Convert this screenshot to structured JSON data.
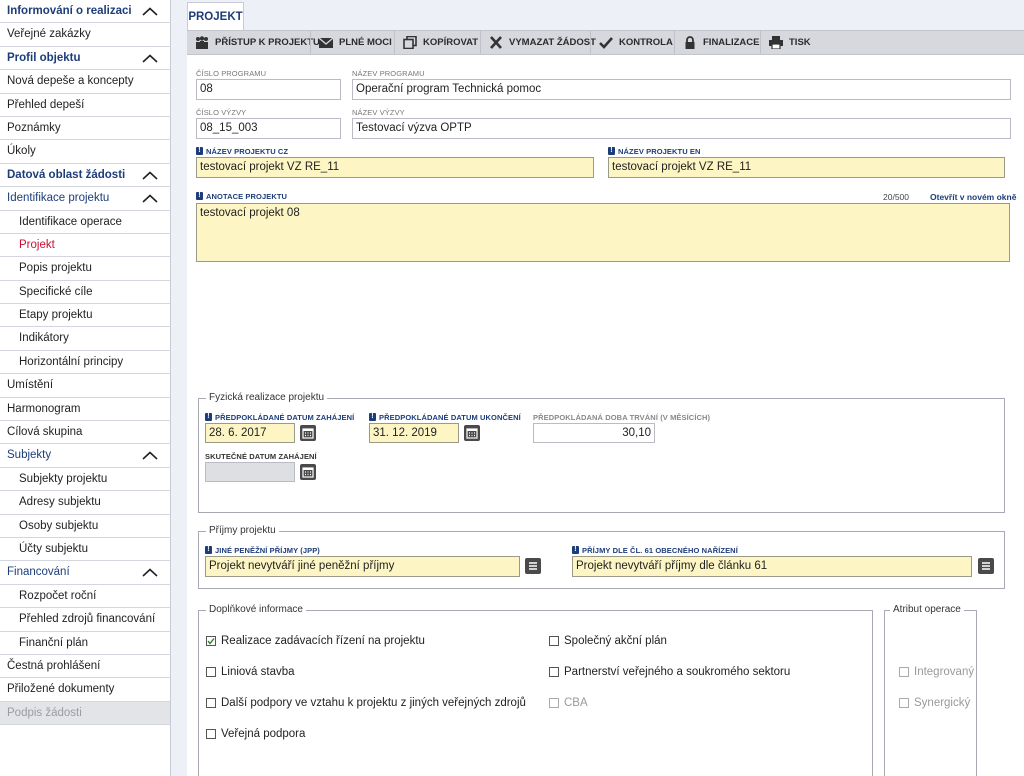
{
  "sidebar": {
    "items": [
      {
        "label": "Informování o realizaci",
        "type": "section",
        "chevron": true
      },
      {
        "label": "Veřejné zakázky",
        "type": "item"
      },
      {
        "label": "Profil objektu",
        "type": "section",
        "chevron": true
      },
      {
        "label": "Nová depeše a koncepty",
        "type": "item"
      },
      {
        "label": "Přehled depeší",
        "type": "item"
      },
      {
        "label": "Poznámky",
        "type": "item"
      },
      {
        "label": "Úkoly",
        "type": "item"
      },
      {
        "label": "Datová oblast žádosti",
        "type": "section",
        "chevron": true
      },
      {
        "label": "Identifikace projektu",
        "type": "section-light",
        "chevron": true
      },
      {
        "label": "Identifikace operace",
        "type": "sub"
      },
      {
        "label": "Projekt",
        "type": "sub-active"
      },
      {
        "label": "Popis projektu",
        "type": "sub"
      },
      {
        "label": "Specifické cíle",
        "type": "sub"
      },
      {
        "label": "Etapy projektu",
        "type": "sub"
      },
      {
        "label": "Indikátory",
        "type": "sub"
      },
      {
        "label": "Horizontální principy",
        "type": "sub"
      },
      {
        "label": "Umístění",
        "type": "item"
      },
      {
        "label": "Harmonogram",
        "type": "item"
      },
      {
        "label": "Cílová skupina",
        "type": "item"
      },
      {
        "label": "Subjekty",
        "type": "section-light",
        "chevron": true
      },
      {
        "label": "Subjekty projektu",
        "type": "sub"
      },
      {
        "label": "Adresy subjektu",
        "type": "sub"
      },
      {
        "label": "Osoby subjektu",
        "type": "sub"
      },
      {
        "label": "Účty subjektu",
        "type": "sub"
      },
      {
        "label": "Financování",
        "type": "section-light",
        "chevron": true
      },
      {
        "label": "Rozpočet roční",
        "type": "sub"
      },
      {
        "label": "Přehled zdrojů financování",
        "type": "sub"
      },
      {
        "label": "Finanční plán",
        "type": "sub"
      },
      {
        "label": "Čestná prohlášení",
        "type": "item"
      },
      {
        "label": "Přiložené dokumenty",
        "type": "item"
      },
      {
        "label": "Podpis žádosti",
        "type": "disabled"
      }
    ]
  },
  "tab": {
    "label": "PROJEKT"
  },
  "toolbar": {
    "access": "PŘÍSTUP K PROJEKTU",
    "powers": "PLNÉ MOCI",
    "copy": "KOPÍROVAT",
    "delete": "VYMAZAT ŽÁDOST",
    "check": "KONTROLA",
    "finalize": "FINALIZACE",
    "print": "TISK"
  },
  "form": {
    "program_number": {
      "label": "ČÍSLO PROGRAMU",
      "value": "08"
    },
    "program_name": {
      "label": "NÁZEV PROGRAMU",
      "value": "Operační program Technická pomoc"
    },
    "call_number": {
      "label": "ČÍSLO VÝZVY",
      "value": "08_15_003"
    },
    "call_name": {
      "label": "NÁZEV VÝZVY",
      "value": "Testovací výzva OPTP"
    },
    "project_name_cz": {
      "label": "NÁZEV PROJEKTU CZ",
      "value": "testovací projekt VZ RE_11"
    },
    "project_name_en": {
      "label": "NÁZEV PROJEKTU EN",
      "value": "testovací projekt VZ RE_11"
    },
    "annotation": {
      "label": "ANOTACE PROJEKTU",
      "value": "testovací projekt 08",
      "counter": "20/500",
      "open_link": "Otevřít v novém okně"
    }
  },
  "physical": {
    "legend": "Fyzická realizace projektu",
    "start_planned": {
      "label": "PŘEDPOKLÁDANÉ DATUM ZAHÁJENÍ",
      "value": "28. 6. 2017"
    },
    "end_planned": {
      "label": "PŘEDPOKLÁDANÉ DATUM UKONČENÍ",
      "value": "31. 12. 2019"
    },
    "duration": {
      "label": "PŘEDPOKLÁDANÁ DOBA TRVÁNÍ (V MĚSÍCÍCH)",
      "value": "30,10"
    },
    "start_actual": {
      "label": "SKUTEČNÉ DATUM ZAHÁJENÍ",
      "value": ""
    }
  },
  "income": {
    "legend": "Příjmy projektu",
    "other": {
      "label": "JINÉ PENĚŽNÍ PŘÍJMY (JPP)",
      "value": "Projekt nevytváří jiné peněžní příjmy"
    },
    "art61": {
      "label": "PŘÍJMY DLE ČL. 61 OBECNÉHO NAŘÍZENÍ",
      "value": "Projekt nevytváří příjmy dle článku 61"
    }
  },
  "extra": {
    "legend": "Doplňkové informace",
    "procurement": {
      "label": "Realizace zadávacích řízení na projektu",
      "checked": true
    },
    "linear": {
      "label": "Liniová stavba",
      "checked": false
    },
    "other_support": {
      "label": "Další podpory ve vztahu k projektu z jiných veřejných zdrojů",
      "checked": false
    },
    "public_support": {
      "label": "Veřejná podpora",
      "checked": false
    },
    "joint_plan": {
      "label": "Společný akční plán",
      "checked": false
    },
    "ppp": {
      "label": "Partnerství veřejného a soukromého sektoru",
      "checked": false
    },
    "cba": {
      "label": "CBA",
      "checked": false
    }
  },
  "attribute": {
    "legend": "Atribut operace",
    "integrated": {
      "label": "Integrovaný",
      "checked": false
    },
    "synergic": {
      "label": "Synergický",
      "checked": false
    }
  }
}
